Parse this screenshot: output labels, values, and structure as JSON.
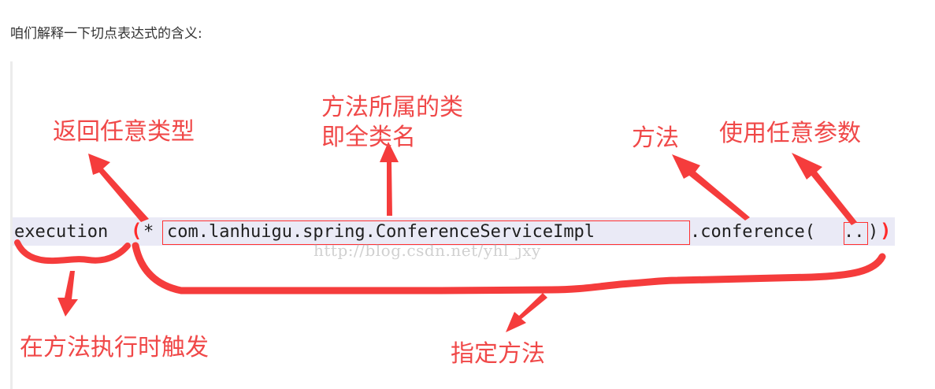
{
  "intro": "咱们解释一下切点表达式的含义:",
  "code": {
    "keyword": "execution",
    "open_paren": "(",
    "star": "*",
    "class_name": "com.lanhuigu.spring.ConferenceServiceImpl",
    "method_part": ".conference(",
    "args": "..",
    "inner_close": ")",
    "close_paren": ")"
  },
  "watermark": "http://blog.csdn.net/yhl_jxy",
  "annotations": {
    "return_type": "返回任意类型",
    "class_line1": "方法所属的类",
    "class_line2": "即全类名",
    "method": "方法",
    "params": "使用任意参数",
    "trigger": "在方法执行时触发",
    "specify": "指定方法"
  },
  "colors": {
    "annotation_red": "#f04848",
    "code_background": "#eaeaf6"
  }
}
